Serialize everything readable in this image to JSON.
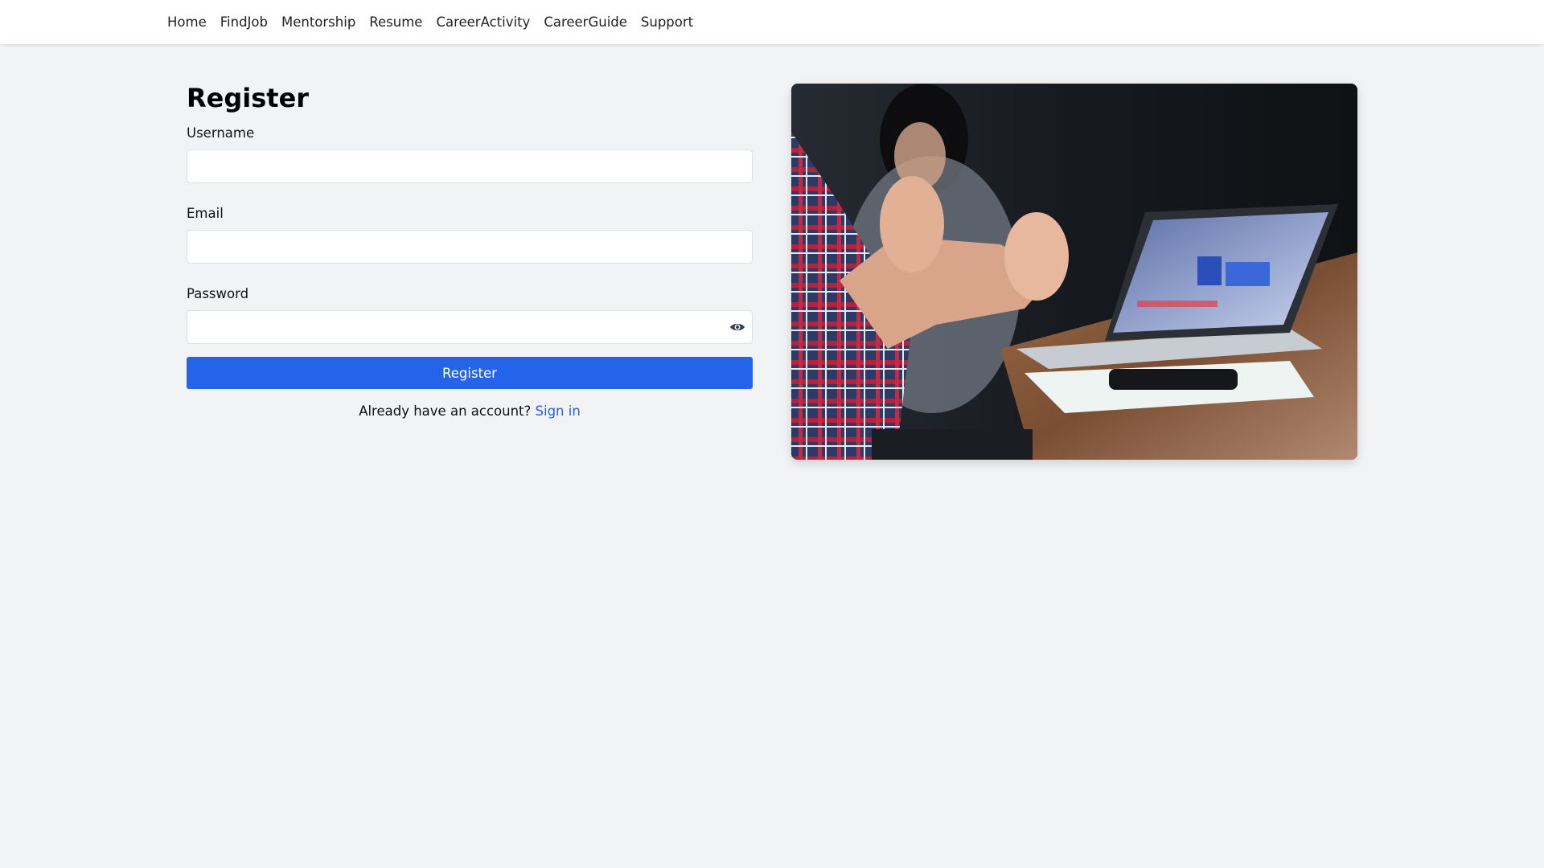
{
  "nav": {
    "items": [
      {
        "label": "Home"
      },
      {
        "label": "FindJob"
      },
      {
        "label": "Mentorship"
      },
      {
        "label": "Resume"
      },
      {
        "label": "CareerActivity"
      },
      {
        "label": "CareerGuide"
      },
      {
        "label": "Support"
      }
    ]
  },
  "form": {
    "title": "Register",
    "username_label": "Username",
    "username_value": "",
    "email_label": "Email",
    "email_value": "",
    "password_label": "Password",
    "password_value": "",
    "password_toggle_icon": "eye-icon",
    "submit_label": "Register",
    "signin_prompt": "Already have an account?",
    "signin_link": "Sign in"
  },
  "hero_image": {
    "subject": "people-at-meeting-table-with-laptop-photo"
  },
  "colors": {
    "accent": "#2563eb",
    "background": "#f2f3f5",
    "navbar": "#ffffff"
  }
}
